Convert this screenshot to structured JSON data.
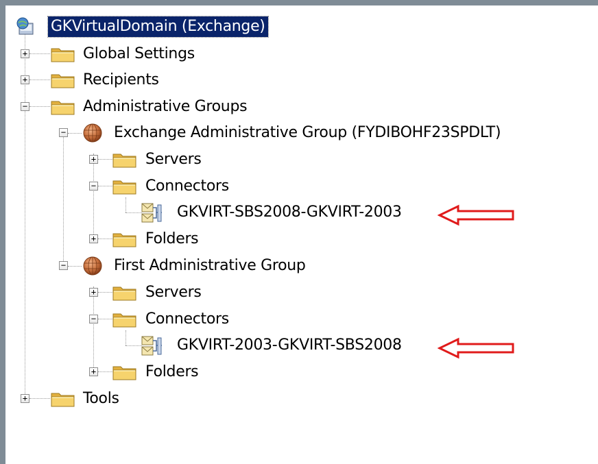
{
  "tree": {
    "root": {
      "label": "GKVirtualDomain (Exchange)"
    },
    "global_settings": {
      "label": "Global Settings",
      "expander": "+"
    },
    "recipients": {
      "label": "Recipients",
      "expander": "+"
    },
    "admin_groups": {
      "label": "Administrative Groups",
      "expander": "−"
    },
    "exchange_group": {
      "label": "Exchange Administrative Group (FYDIBOHF23SPDLT)",
      "expander": "−",
      "servers": {
        "label": "Servers",
        "expander": "+"
      },
      "connectors": {
        "label": "Connectors",
        "expander": "−"
      },
      "connector": {
        "label": "GKVIRT-SBS2008-GKVIRT-2003"
      },
      "folders": {
        "label": "Folders",
        "expander": "+"
      }
    },
    "first_group": {
      "label": "First Administrative Group",
      "expander": "−",
      "servers": {
        "label": "Servers",
        "expander": "+"
      },
      "connectors": {
        "label": "Connectors",
        "expander": "−"
      },
      "connector": {
        "label": "GKVIRT-2003-GKVIRT-SBS2008"
      },
      "folders": {
        "label": "Folders",
        "expander": "+"
      }
    },
    "tools": {
      "label": "Tools",
      "expander": "+"
    }
  },
  "annotations": {
    "arrow_color": "#e01b1b"
  },
  "colors": {
    "selection": "#0a246a",
    "folder": "#f2c85a"
  }
}
